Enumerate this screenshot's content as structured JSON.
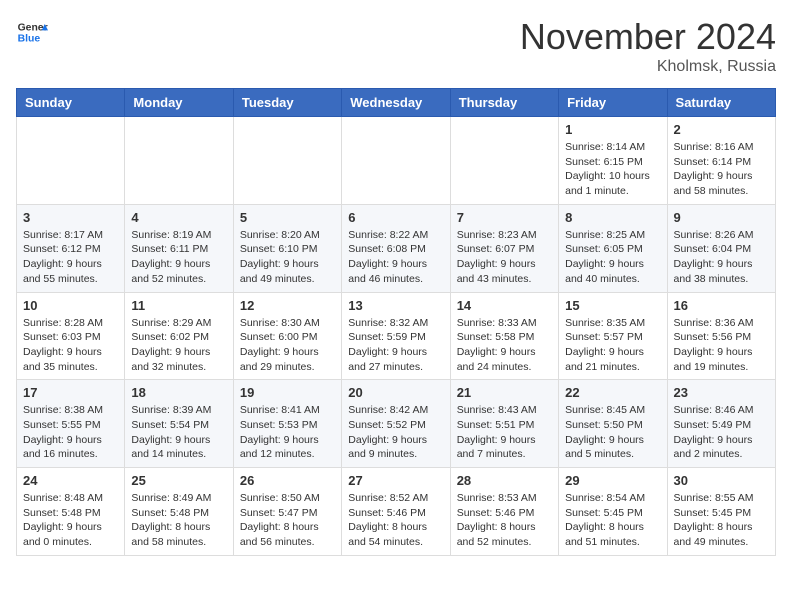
{
  "header": {
    "logo": {
      "general": "General",
      "blue": "Blue"
    },
    "title": "November 2024",
    "location": "Kholmsk, Russia"
  },
  "weekdays": [
    "Sunday",
    "Monday",
    "Tuesday",
    "Wednesday",
    "Thursday",
    "Friday",
    "Saturday"
  ],
  "weeks": [
    [
      {
        "day": "",
        "info": ""
      },
      {
        "day": "",
        "info": ""
      },
      {
        "day": "",
        "info": ""
      },
      {
        "day": "",
        "info": ""
      },
      {
        "day": "",
        "info": ""
      },
      {
        "day": "1",
        "info": "Sunrise: 8:14 AM\nSunset: 6:15 PM\nDaylight: 10 hours and 1 minute."
      },
      {
        "day": "2",
        "info": "Sunrise: 8:16 AM\nSunset: 6:14 PM\nDaylight: 9 hours and 58 minutes."
      }
    ],
    [
      {
        "day": "3",
        "info": "Sunrise: 8:17 AM\nSunset: 6:12 PM\nDaylight: 9 hours and 55 minutes."
      },
      {
        "day": "4",
        "info": "Sunrise: 8:19 AM\nSunset: 6:11 PM\nDaylight: 9 hours and 52 minutes."
      },
      {
        "day": "5",
        "info": "Sunrise: 8:20 AM\nSunset: 6:10 PM\nDaylight: 9 hours and 49 minutes."
      },
      {
        "day": "6",
        "info": "Sunrise: 8:22 AM\nSunset: 6:08 PM\nDaylight: 9 hours and 46 minutes."
      },
      {
        "day": "7",
        "info": "Sunrise: 8:23 AM\nSunset: 6:07 PM\nDaylight: 9 hours and 43 minutes."
      },
      {
        "day": "8",
        "info": "Sunrise: 8:25 AM\nSunset: 6:05 PM\nDaylight: 9 hours and 40 minutes."
      },
      {
        "day": "9",
        "info": "Sunrise: 8:26 AM\nSunset: 6:04 PM\nDaylight: 9 hours and 38 minutes."
      }
    ],
    [
      {
        "day": "10",
        "info": "Sunrise: 8:28 AM\nSunset: 6:03 PM\nDaylight: 9 hours and 35 minutes."
      },
      {
        "day": "11",
        "info": "Sunrise: 8:29 AM\nSunset: 6:02 PM\nDaylight: 9 hours and 32 minutes."
      },
      {
        "day": "12",
        "info": "Sunrise: 8:30 AM\nSunset: 6:00 PM\nDaylight: 9 hours and 29 minutes."
      },
      {
        "day": "13",
        "info": "Sunrise: 8:32 AM\nSunset: 5:59 PM\nDaylight: 9 hours and 27 minutes."
      },
      {
        "day": "14",
        "info": "Sunrise: 8:33 AM\nSunset: 5:58 PM\nDaylight: 9 hours and 24 minutes."
      },
      {
        "day": "15",
        "info": "Sunrise: 8:35 AM\nSunset: 5:57 PM\nDaylight: 9 hours and 21 minutes."
      },
      {
        "day": "16",
        "info": "Sunrise: 8:36 AM\nSunset: 5:56 PM\nDaylight: 9 hours and 19 minutes."
      }
    ],
    [
      {
        "day": "17",
        "info": "Sunrise: 8:38 AM\nSunset: 5:55 PM\nDaylight: 9 hours and 16 minutes."
      },
      {
        "day": "18",
        "info": "Sunrise: 8:39 AM\nSunset: 5:54 PM\nDaylight: 9 hours and 14 minutes."
      },
      {
        "day": "19",
        "info": "Sunrise: 8:41 AM\nSunset: 5:53 PM\nDaylight: 9 hours and 12 minutes."
      },
      {
        "day": "20",
        "info": "Sunrise: 8:42 AM\nSunset: 5:52 PM\nDaylight: 9 hours and 9 minutes."
      },
      {
        "day": "21",
        "info": "Sunrise: 8:43 AM\nSunset: 5:51 PM\nDaylight: 9 hours and 7 minutes."
      },
      {
        "day": "22",
        "info": "Sunrise: 8:45 AM\nSunset: 5:50 PM\nDaylight: 9 hours and 5 minutes."
      },
      {
        "day": "23",
        "info": "Sunrise: 8:46 AM\nSunset: 5:49 PM\nDaylight: 9 hours and 2 minutes."
      }
    ],
    [
      {
        "day": "24",
        "info": "Sunrise: 8:48 AM\nSunset: 5:48 PM\nDaylight: 9 hours and 0 minutes."
      },
      {
        "day": "25",
        "info": "Sunrise: 8:49 AM\nSunset: 5:48 PM\nDaylight: 8 hours and 58 minutes."
      },
      {
        "day": "26",
        "info": "Sunrise: 8:50 AM\nSunset: 5:47 PM\nDaylight: 8 hours and 56 minutes."
      },
      {
        "day": "27",
        "info": "Sunrise: 8:52 AM\nSunset: 5:46 PM\nDaylight: 8 hours and 54 minutes."
      },
      {
        "day": "28",
        "info": "Sunrise: 8:53 AM\nSunset: 5:46 PM\nDaylight: 8 hours and 52 minutes."
      },
      {
        "day": "29",
        "info": "Sunrise: 8:54 AM\nSunset: 5:45 PM\nDaylight: 8 hours and 51 minutes."
      },
      {
        "day": "30",
        "info": "Sunrise: 8:55 AM\nSunset: 5:45 PM\nDaylight: 8 hours and 49 minutes."
      }
    ]
  ]
}
